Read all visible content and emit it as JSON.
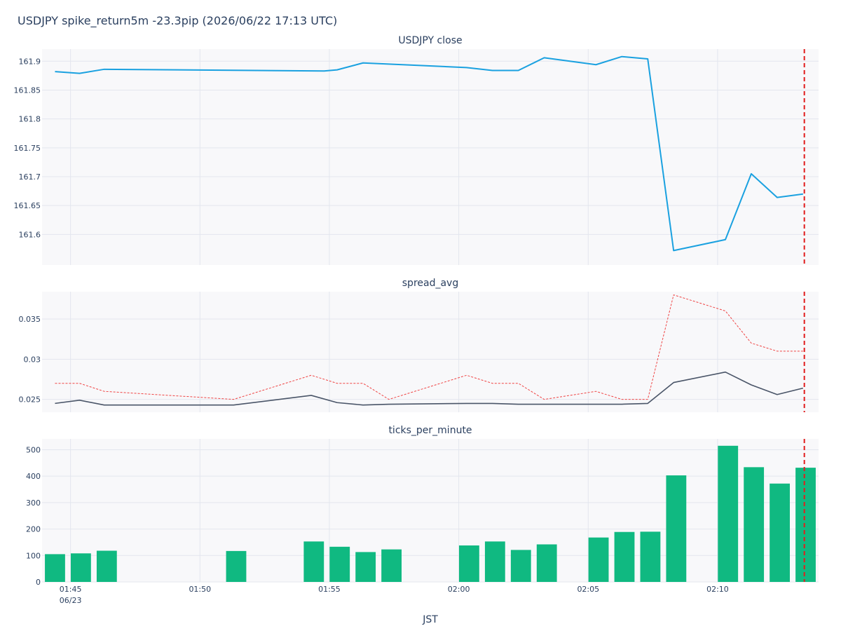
{
  "title": "USDJPY spike_return5m -23.3pip (2026/06/22 17:13 UTC)",
  "colors": {
    "plot_bg": "#f8f8fa",
    "grid": "#e3e6ee",
    "close_line": "#1aa1e0",
    "spread_line": "#4a5568",
    "spread_dotted": "#ef4444",
    "bars": "#10b981",
    "marker": "#e11d1d"
  },
  "chart_data": {
    "xlabel": "JST",
    "x_tick_labels": [
      "01:45",
      "01:50",
      "01:55",
      "02:00",
      "02:05",
      "02:10"
    ],
    "x_tick_minutes": [
      0,
      5,
      10,
      15,
      20,
      25
    ],
    "x_date_label": "06/23",
    "x_range_minutes": [
      -1.1,
      28.9
    ],
    "spike_marker_minute": 28.35,
    "panels": [
      {
        "type": "line",
        "title": "USDJPY close",
        "ylim": [
          161.547,
          161.921
        ],
        "y_ticks": [
          161.6,
          161.65,
          161.7,
          161.75,
          161.8,
          161.85,
          161.9
        ],
        "y_tick_labels": [
          "161.6",
          "161.65",
          "161.7",
          "161.75",
          "161.8",
          "161.85",
          "161.9"
        ],
        "series": [
          {
            "line_style": "solid",
            "x": [
              -0.6,
              0.35,
              1.3,
              9.8,
              10.3,
              11.3,
              15.3,
              16.3,
              17.3,
              18.3,
              20.3,
              21.3,
              22.3,
              23.3,
              25.3,
              26.3,
              27.3,
              28.3
            ],
            "y": [
              161.882,
              161.879,
              161.886,
              161.883,
              161.885,
              161.897,
              161.889,
              161.884,
              161.884,
              161.906,
              161.894,
              161.908,
              161.904,
              161.572,
              161.591,
              161.705,
              161.664,
              161.67
            ]
          }
        ]
      },
      {
        "type": "line",
        "title": "spread_avg",
        "ylim": [
          0.0234,
          0.0384
        ],
        "y_ticks": [
          0.025,
          0.03,
          0.035
        ],
        "y_tick_labels": [
          "0.025",
          "0.03",
          "0.035"
        ],
        "series": [
          {
            "line_style": "solid",
            "x": [
              -0.6,
              0.35,
              1.3,
              6.3,
              9.3,
              10.3,
              11.3,
              12.3,
              15.3,
              16.3,
              17.3,
              18.3,
              20.3,
              21.3,
              22.3,
              23.3,
              25.3,
              26.3,
              27.3,
              28.3
            ],
            "y": [
              0.0245,
              0.0249,
              0.0243,
              0.0243,
              0.0255,
              0.0246,
              0.0243,
              0.0244,
              0.0245,
              0.0245,
              0.0244,
              0.0244,
              0.0244,
              0.0244,
              0.0245,
              0.0271,
              0.0284,
              0.0268,
              0.0256,
              0.0264
            ]
          },
          {
            "line_style": "dotted",
            "x": [
              -0.6,
              0.35,
              1.3,
              6.3,
              9.3,
              10.3,
              11.3,
              12.3,
              15.3,
              16.3,
              17.3,
              18.3,
              20.3,
              21.3,
              22.3,
              23.3,
              25.3,
              26.3,
              27.3,
              28.3
            ],
            "y": [
              0.027,
              0.027,
              0.026,
              0.025,
              0.028,
              0.027,
              0.027,
              0.025,
              0.028,
              0.027,
              0.027,
              0.025,
              0.026,
              0.025,
              0.025,
              0.038,
              0.036,
              0.032,
              0.031,
              0.031
            ]
          }
        ]
      },
      {
        "type": "bar",
        "title": "ticks_per_minute",
        "ylim": [
          0,
          541
        ],
        "y_ticks": [
          0,
          100,
          200,
          300,
          400,
          500
        ],
        "y_tick_labels": [
          "0",
          "100",
          "200",
          "300",
          "400",
          "500"
        ],
        "bar_width_minutes": 0.78,
        "x": [
          -0.6,
          0.4,
          1.4,
          6.4,
          9.4,
          10.4,
          11.4,
          12.4,
          15.4,
          16.4,
          17.4,
          18.4,
          20.4,
          21.4,
          22.4,
          23.4,
          25.4,
          26.4,
          27.4,
          28.4
        ],
        "values": [
          105,
          108,
          118,
          117,
          153,
          133,
          113,
          123,
          138,
          153,
          121,
          142,
          168,
          189,
          190,
          403,
          515,
          434,
          372,
          432
        ]
      }
    ]
  }
}
